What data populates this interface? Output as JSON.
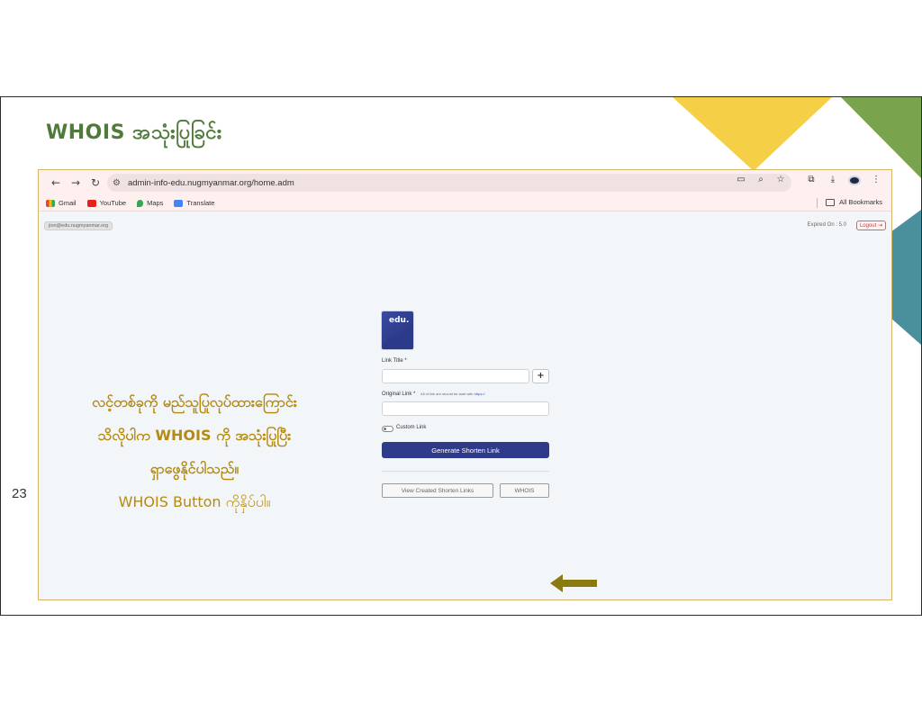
{
  "slide": {
    "title": "WHOIS အသုံးပြုခြင်း",
    "page_number": "23",
    "annotation": {
      "line1": "လင့်တစ်ခုကို မည်သူပြုလုပ်ထားကြောင်း",
      "line2": "သိလိုပါက WHOIS ကို အသုံးပြုပြီး",
      "line3": "ရှာဖွေနိုင်ပါသည်။",
      "line4": "WHOIS Button ကိုနှိပ်ပါ။"
    },
    "colors": {
      "title": "#4f7a3a",
      "annotation": "#b58a10",
      "deco_yellow": "#f5cf45",
      "deco_green": "#79a34c",
      "deco_teal": "#4a8f9c"
    }
  },
  "browser": {
    "url": "admin-info-edu.nugmyanmar.org/home.adm",
    "nav_icons": [
      "back-arrow-icon",
      "forward-arrow-icon",
      "reload-icon"
    ],
    "bookmarks": [
      {
        "label": "Gmail",
        "icon": "gmail-icon"
      },
      {
        "label": "YouTube",
        "icon": "youtube-icon"
      },
      {
        "label": "Maps",
        "icon": "maps-icon"
      },
      {
        "label": "Translate",
        "icon": "translate-icon"
      }
    ],
    "all_bookmarks": "All Bookmarks"
  },
  "app": {
    "user_email": "jion@edu.nugmyanmar.org",
    "expired_on": "Expired On : 5.0",
    "logout_label": "Logout ⇥",
    "logo_text": "edu.",
    "link_title_label": "Link Title *",
    "original_link_label": "Original Link *",
    "original_link_hint": "All of link are should be start with",
    "original_link_hint_link": "https://",
    "custom_link_label": "Custom Link",
    "generate_button": "Generate Shorten Link",
    "view_links_button": "View Created Shorten Links",
    "whois_button": "WHOIS",
    "plus_symbol": "+",
    "accent_color": "#2f3a8a"
  }
}
